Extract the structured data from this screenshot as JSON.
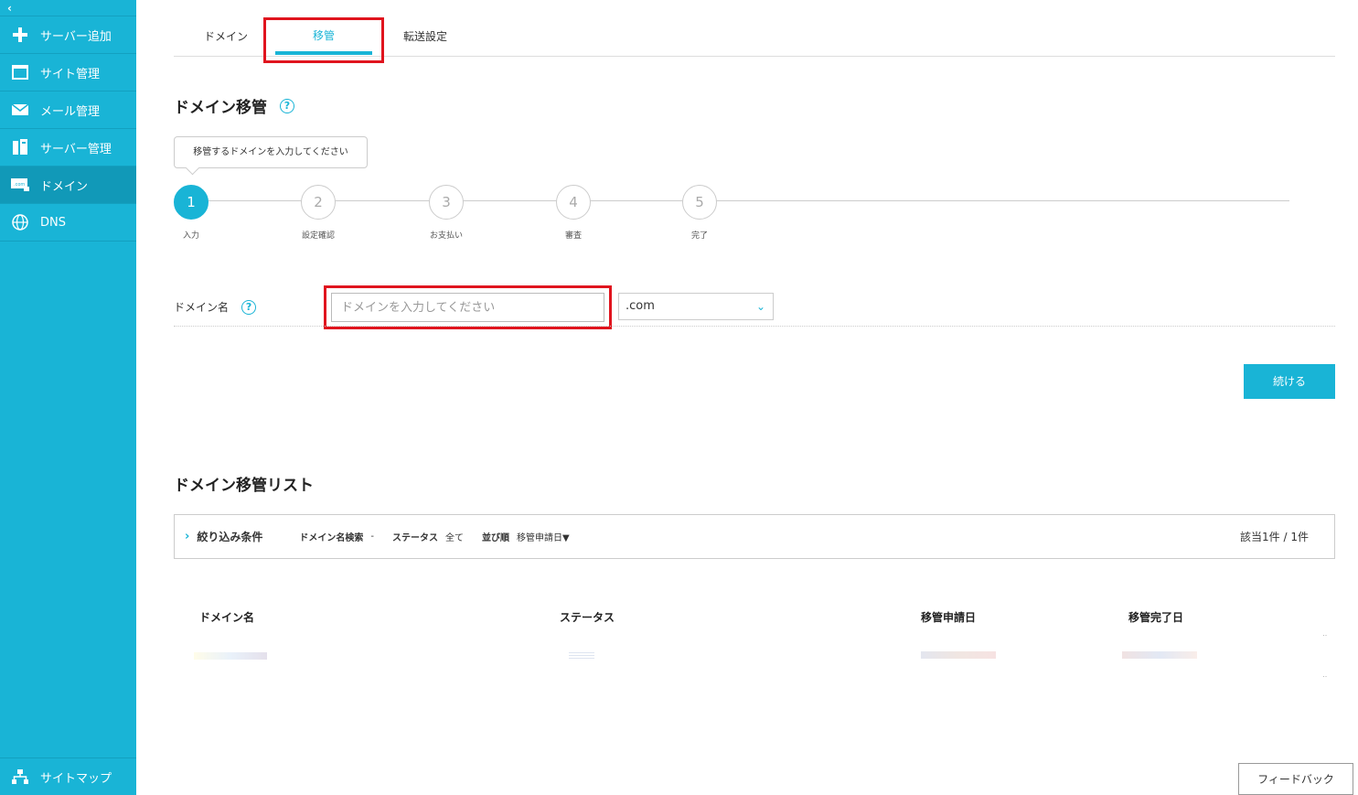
{
  "sidebar": {
    "collapse_glyph": "‹",
    "items": [
      {
        "label": "サーバー追加",
        "icon": "plus-icon"
      },
      {
        "label": "サイト管理",
        "icon": "window-icon"
      },
      {
        "label": "メール管理",
        "icon": "mail-icon"
      },
      {
        "label": "サーバー管理",
        "icon": "server-icon"
      },
      {
        "label": "ドメイン",
        "icon": "domain-icon"
      },
      {
        "label": "DNS",
        "icon": "globe-icon"
      }
    ],
    "bottom": {
      "label": "サイトマップ",
      "icon": "sitemap-icon"
    }
  },
  "tabs": [
    {
      "label": "ドメイン"
    },
    {
      "label": "移管"
    },
    {
      "label": "転送設定"
    }
  ],
  "transfer": {
    "title": "ドメイン移管",
    "help_glyph": "?",
    "tooltip": "移管するドメインを入力してください",
    "steps": [
      {
        "number": "1",
        "label": "入力"
      },
      {
        "number": "2",
        "label": "設定確認"
      },
      {
        "number": "3",
        "label": "お支払い"
      },
      {
        "number": "4",
        "label": "審査"
      },
      {
        "number": "5",
        "label": "完了"
      }
    ],
    "field_label": "ドメイン名",
    "input_placeholder": "ドメインを入力してください",
    "tld_selected": ".com",
    "continue_label": "続ける"
  },
  "list": {
    "title": "ドメイン移管リスト",
    "filter_title": "絞り込み条件",
    "search_label": "ドメイン名検索",
    "search_value": "-",
    "status_label": "ステータス",
    "status_value": "全て",
    "sort_label": "並び順",
    "sort_value": "移管申請日▼",
    "count": "該当1件 / 1件",
    "columns": [
      "ドメイン名",
      "ステータス",
      "移管申請日",
      "移管完了日"
    ]
  },
  "feedback_label": "フィードバック",
  "colors": {
    "accent": "#19b4d6",
    "highlight": "#e0141e"
  }
}
